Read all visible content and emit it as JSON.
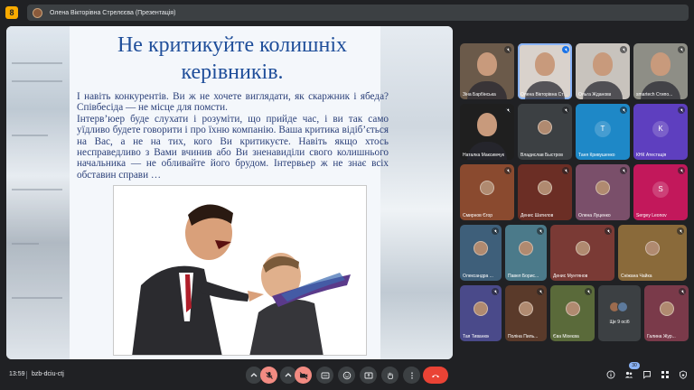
{
  "topbar": {
    "app_badge": "8",
    "presenter_label": "Олена Вікторівна Стрелєєва (Презентація)"
  },
  "slide": {
    "title_line1": "Не критикуйте колишніх",
    "title_line2": "керівників.",
    "paragraph1": "І навіть конкурентів. Ви ж не хочете виглядати, як скаржник і ябеда? Співбесіда — не місце для помсти.",
    "paragraph2": "Інтерв’юер буде слухати і розуміти, що прийде час, і ви так само уїдливо будете говорити і про їхню компанію. Ваша критика відіб’ється на Вас, а не на тих, кого Ви критикуєте. Навіть якщо хтось несправедливо з Вами вчинив або Ви зненавиділи свого колишнього начальника — не обливайте його брудом. Інтервьер ж не знає всіх обставин справи …"
  },
  "participants": [
    {
      "name": "Зіна Барбінська",
      "kind": "video",
      "bg": "#6b5a4a"
    },
    {
      "name": "Олена Вікторівна Стрелєєва",
      "kind": "video",
      "bg": "#d9d2cc",
      "speaking": true
    },
    {
      "name": "Ольга Жданова",
      "kind": "video",
      "bg": "#c8c3bd"
    },
    {
      "name": "smartech Стипо...",
      "kind": "video",
      "bg": "#8e8e86"
    },
    {
      "name": "Наталка Максимчук",
      "kind": "video",
      "bg": "#1f1f1f"
    },
    {
      "name": "Владислав Быстров",
      "kind": "photo",
      "bg": "#3c4043"
    },
    {
      "name": "Таня Кривушенко",
      "kind": "letter",
      "letter": "T",
      "bg": "#1e88c7"
    },
    {
      "name": "КНК Атестація",
      "kind": "letter",
      "letter": "K",
      "bg": "#5e3fbf"
    },
    {
      "name": "Смирнов Єгор",
      "kind": "photo",
      "bg": "#8a4a2f"
    },
    {
      "name": "Денис Шатилов",
      "kind": "photo",
      "bg": "#6b2e25"
    },
    {
      "name": "Олена Луценко",
      "kind": "photo",
      "bg": "#7a4f6a"
    },
    {
      "name": "Sergey Leonov",
      "kind": "letter",
      "letter": "S",
      "bg": "#c2185b"
    },
    {
      "name": "Олександра ...",
      "kind": "photo",
      "bg": "#3e5f7a"
    },
    {
      "name": "Павел Борис...",
      "kind": "photo",
      "bg": "#4b7a8a"
    },
    {
      "name": "Денис Мунтянов",
      "kind": "photo",
      "bg": "#7a3a35"
    },
    {
      "name": "Сніжана Чайка",
      "kind": "photo",
      "bg": "#8a6a3a"
    },
    {
      "name": "Тая Тиванюк",
      "kind": "photo",
      "bg": "#4a4a8a"
    },
    {
      "name": "Поліна Пиль...",
      "kind": "photo",
      "bg": "#5a3a2a"
    },
    {
      "name": "Єва Міхеєва",
      "kind": "photo",
      "bg": "#5a6a3a"
    },
    {
      "name": "Ще 9 осіб",
      "kind": "more",
      "bg": "#3c4043"
    },
    {
      "name": "Галина Жур...",
      "kind": "photo",
      "bg": "#7a3a4a"
    }
  ],
  "bottombar": {
    "time": "13:59",
    "meeting_code": "bzb-dciu-ctj",
    "people_count": "30"
  }
}
